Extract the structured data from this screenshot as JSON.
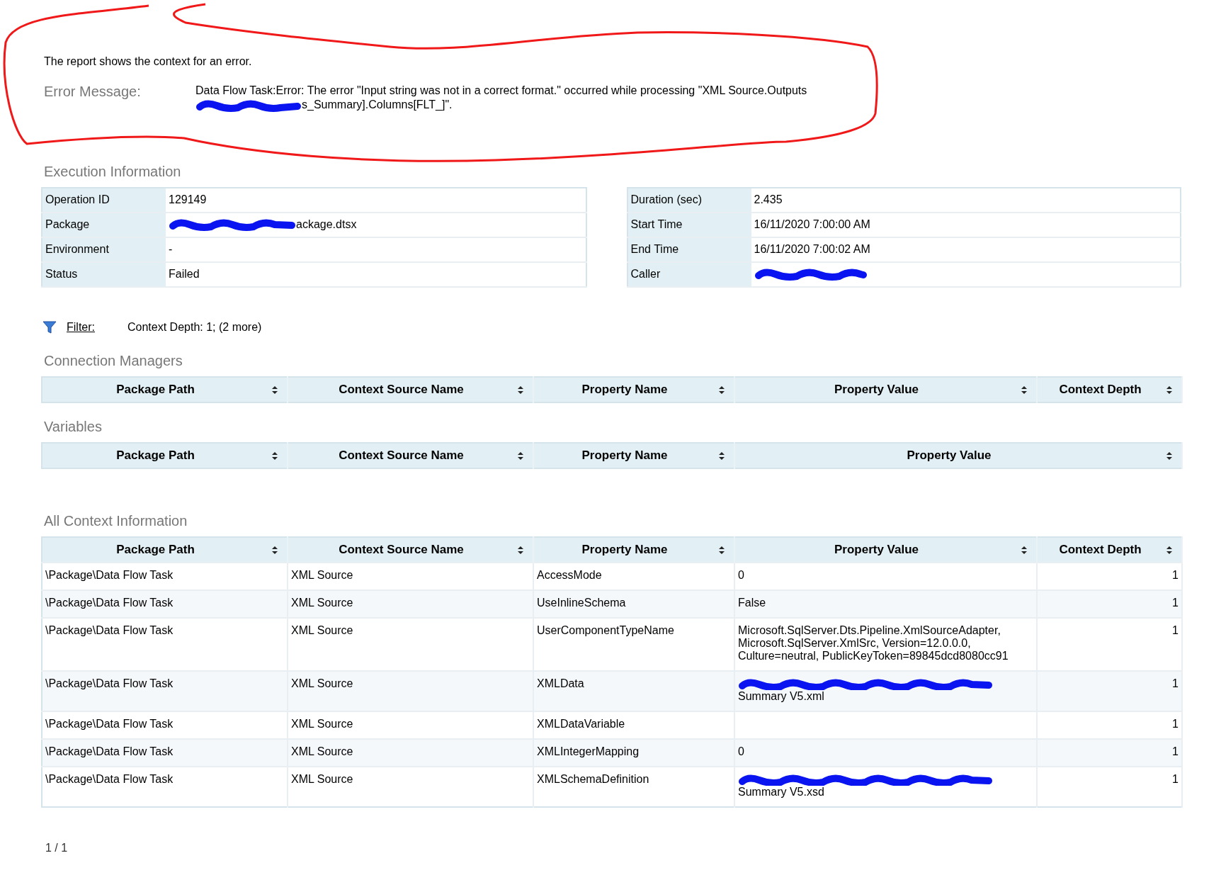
{
  "report": {
    "description": "The report shows the context for an error.",
    "error_message": {
      "label": "Error Message:",
      "lines": [
        {
          "text": "Data Flow Task:Error: The error \"Input string was not in a correct format.\" occurred while processing \"XML Source.Outputs"
        },
        {
          "text": "s_Summary].Columns[FLT_]\".",
          "redacted": true
        }
      ]
    }
  },
  "execution_information": {
    "title": "Execution Information",
    "left": [
      {
        "label": "Operation ID",
        "value": "129149"
      },
      {
        "label": "Package",
        "value": "ackage.dtsx",
        "redacted": true
      },
      {
        "label": "Environment",
        "value": "-"
      },
      {
        "label": "Status",
        "value": "Failed"
      }
    ],
    "right": [
      {
        "label": "Duration (sec)",
        "value": "2.435"
      },
      {
        "label": "Start Time",
        "value": "16/11/2020 7:00:00 AM"
      },
      {
        "label": "End Time",
        "value": "16/11/2020 7:00:02 AM"
      },
      {
        "label": "Caller",
        "redacted": true
      }
    ]
  },
  "filter": {
    "label": "Filter:",
    "summary": "Context Depth: 1;  (2 more)"
  },
  "sections": [
    {
      "title": "Connection Managers",
      "columns": [
        {
          "label": "Package Path"
        },
        {
          "label": "Context Source Name"
        },
        {
          "label": "Property Name"
        },
        {
          "label": "Property Value"
        },
        {
          "label": "Context Depth"
        }
      ]
    },
    {
      "title": "Variables",
      "columns": [
        {
          "label": "Package Path"
        },
        {
          "label": "Context Source Name"
        },
        {
          "label": "Property Name"
        },
        {
          "label": "Property Value"
        }
      ]
    },
    {
      "title": "All Context Information",
      "columns": [
        {
          "label": "Package Path"
        },
        {
          "label": "Context Source Name"
        },
        {
          "label": "Property Name"
        },
        {
          "label": "Property Value"
        },
        {
          "label": "Context Depth"
        }
      ],
      "rows": [
        {
          "cells": [
            {
              "text": "\\Package\\Data Flow Task"
            },
            {
              "text": "XML Source"
            },
            {
              "text": "AccessMode"
            },
            {
              "text": "0"
            },
            {
              "text": "1"
            }
          ]
        },
        {
          "cells": [
            {
              "text": "\\Package\\Data Flow Task"
            },
            {
              "text": "XML Source"
            },
            {
              "text": "UseInlineSchema"
            },
            {
              "text": "False"
            },
            {
              "text": "1"
            }
          ]
        },
        {
          "cells": [
            {
              "text": "\\Package\\Data Flow Task"
            },
            {
              "text": "XML Source"
            },
            {
              "text": "UserComponentTypeName"
            },
            {
              "text": "Microsoft.SqlServer.Dts.Pipeline.XmlSourceAdapter, Microsoft.SqlServer.XmlSrc, Version=12.0.0.0, Culture=neutral, PublicKeyToken=89845dcd8080cc91"
            },
            {
              "text": "1"
            }
          ]
        },
        {
          "cells": [
            {
              "text": "\\Package\\Data Flow Task"
            },
            {
              "text": "XML Source"
            },
            {
              "text": "XMLData"
            },
            {
              "text": "Summary V5.xml",
              "redacted": true
            },
            {
              "text": "1"
            }
          ]
        },
        {
          "cells": [
            {
              "text": "\\Package\\Data Flow Task"
            },
            {
              "text": "XML Source"
            },
            {
              "text": "XMLDataVariable"
            },
            {},
            {
              "text": "1"
            }
          ]
        },
        {
          "cells": [
            {
              "text": "\\Package\\Data Flow Task"
            },
            {
              "text": "XML Source"
            },
            {
              "text": "XMLIntegerMapping"
            },
            {
              "text": "0"
            },
            {
              "text": "1"
            }
          ]
        },
        {
          "cells": [
            {
              "text": "\\Package\\Data Flow Task"
            },
            {
              "text": "XML Source"
            },
            {
              "text": "XMLSchemaDefinition"
            },
            {
              "text": "Summary V5.xsd",
              "redacted": true
            },
            {
              "text": "1"
            }
          ]
        }
      ]
    }
  ],
  "pager": "1 / 1"
}
